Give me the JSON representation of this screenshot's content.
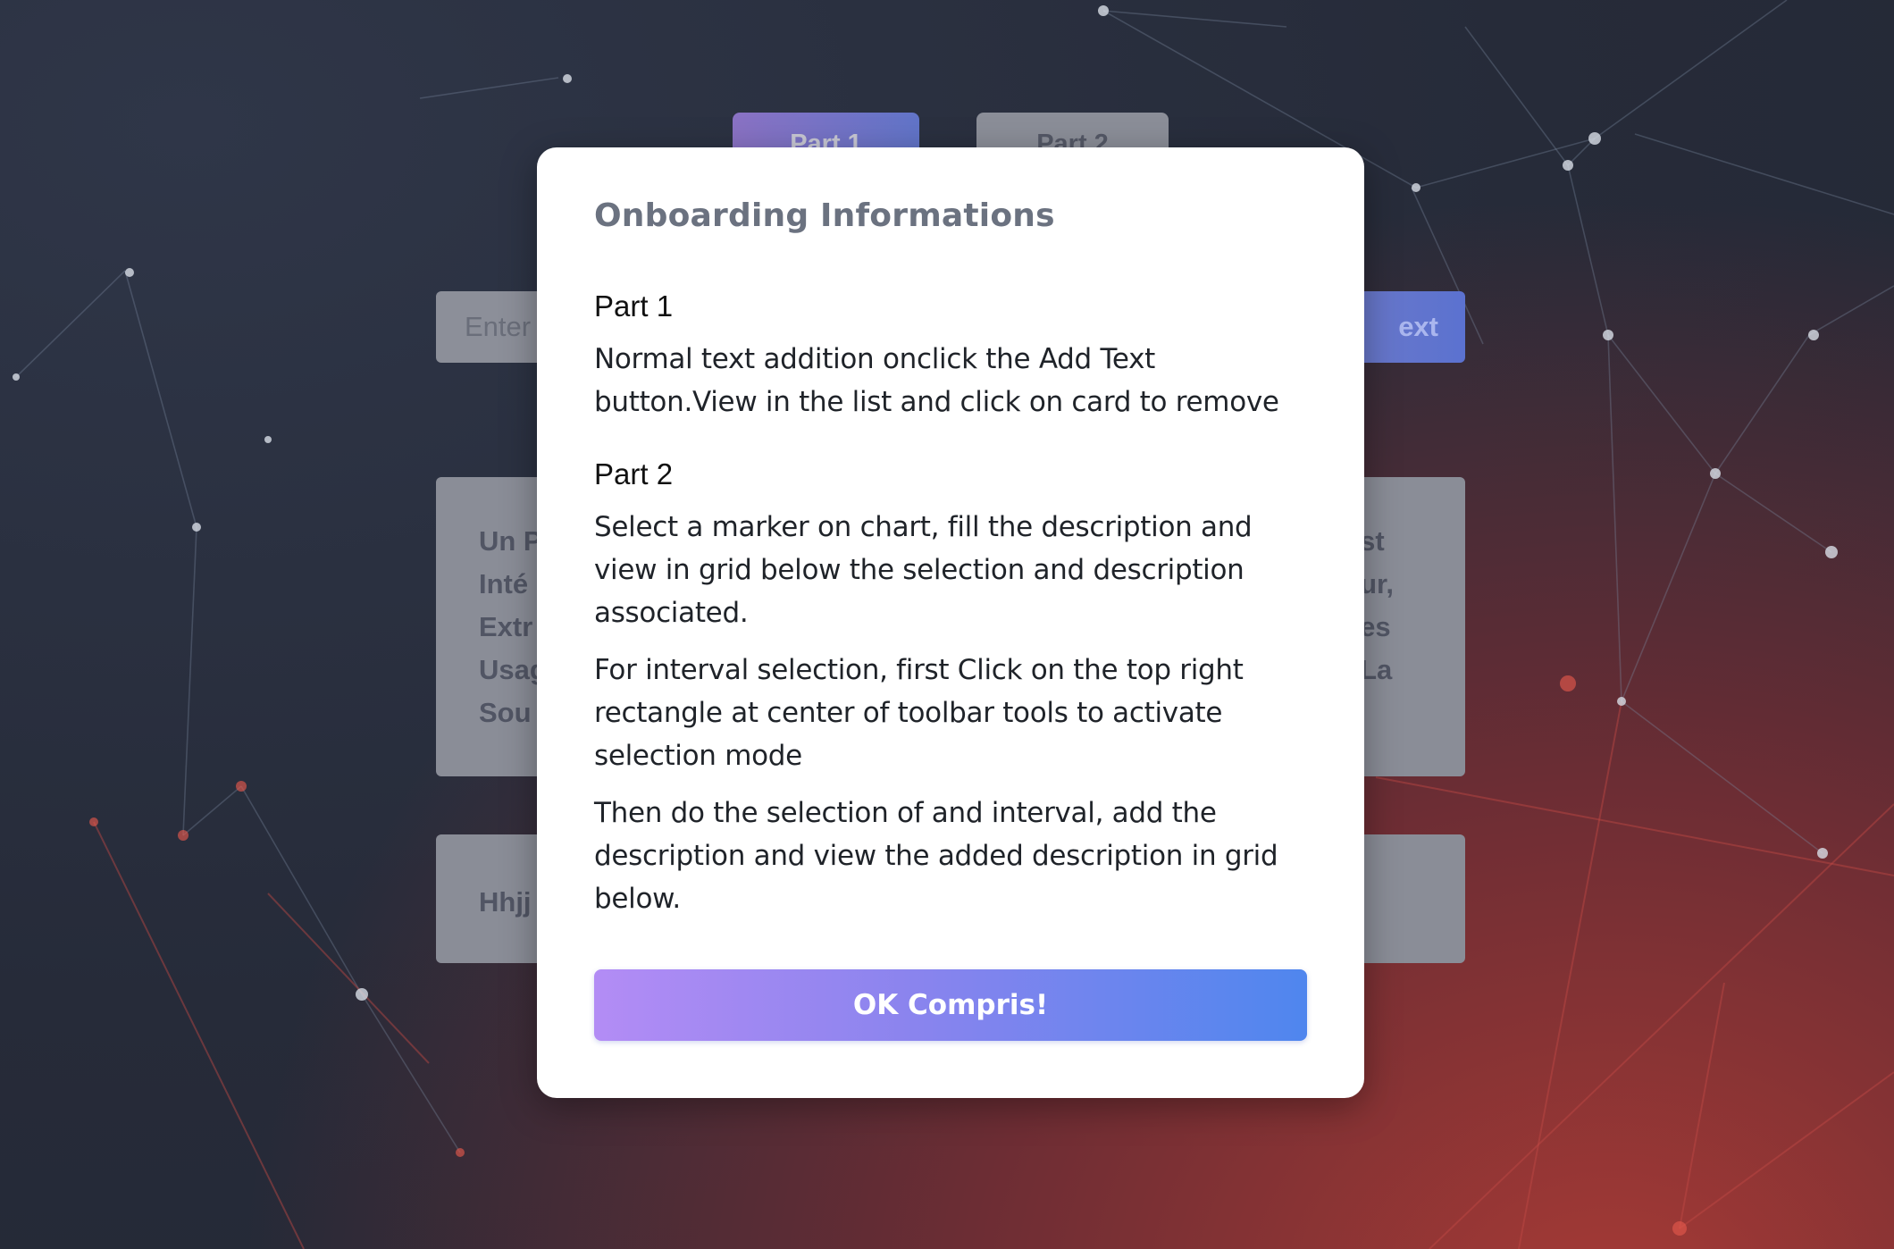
{
  "tabs": [
    {
      "label": "Part 1"
    },
    {
      "label": "Part 2"
    }
  ],
  "input": {
    "placeholder": "Enter"
  },
  "add_button": {
    "label": "ext"
  },
  "cards": [
    {
      "left_lines": [
        "Un P",
        "Inté",
        "Extr",
        "Usag",
        "Sou"
      ],
      "right_lines": [
        "st",
        "ur,",
        "es",
        "La"
      ]
    },
    {
      "left_lines": [
        "Hhjj"
      ],
      "right_lines": []
    }
  ],
  "modal": {
    "title": "Onboarding Informations",
    "part1": {
      "heading": "Part 1",
      "text": "Normal text addition onclick the Add Text button.View in the list and click on card to remove"
    },
    "part2": {
      "heading": "Part 2",
      "paragraphs": [
        "Select a marker on chart, fill the description and view in grid below the selection and description associated.",
        "For interval selection, first Click on the top right rectangle at center of toolbar tools to activate selection mode",
        "Then do the selection of and interval, add the description and view the added description in grid below."
      ]
    },
    "ok_button": "OK Compris!"
  }
}
